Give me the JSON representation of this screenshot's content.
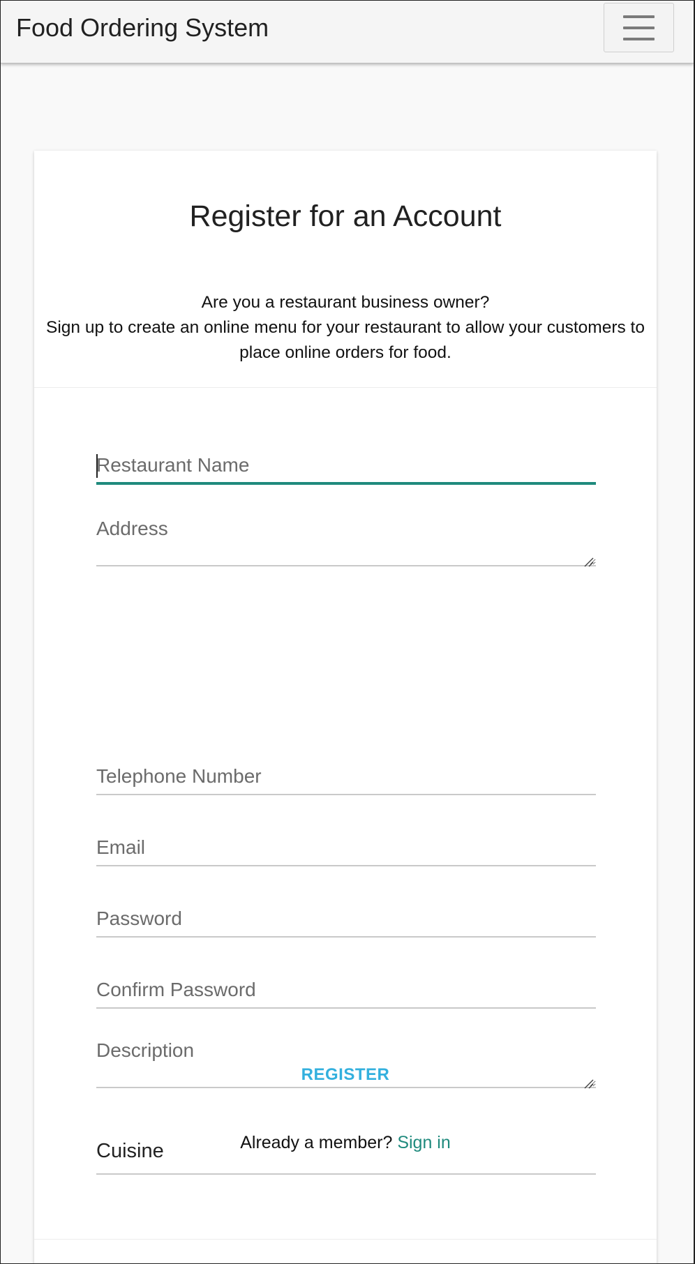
{
  "navbar": {
    "brand": "Food Ordering System",
    "menu_icon": "hamburger-menu-icon"
  },
  "card": {
    "title": "Register for an Account",
    "intro_line1": "Are you a restaurant business owner?",
    "intro_line2": "Sign up to create an online menu for your restaurant to allow your customers to",
    "intro_line3": "place online orders for food."
  },
  "form": {
    "restaurant_name": {
      "placeholder": "Restaurant Name",
      "value": ""
    },
    "address": {
      "placeholder": "Address",
      "value": ""
    },
    "telephone": {
      "placeholder": "Telephone Number",
      "value": ""
    },
    "email": {
      "placeholder": "Email",
      "value": ""
    },
    "password": {
      "placeholder": "Password",
      "value": ""
    },
    "confirm_password": {
      "placeholder": "Confirm Password",
      "value": ""
    },
    "description": {
      "placeholder": "Description",
      "value": ""
    },
    "cuisine": {
      "selected": "Cuisine"
    },
    "register_label": "REGISTER",
    "already_member": "Already a member?",
    "sign_in_label": "Sign in"
  },
  "colors": {
    "accent": "#1f8a7d",
    "register": "#33b0de"
  }
}
